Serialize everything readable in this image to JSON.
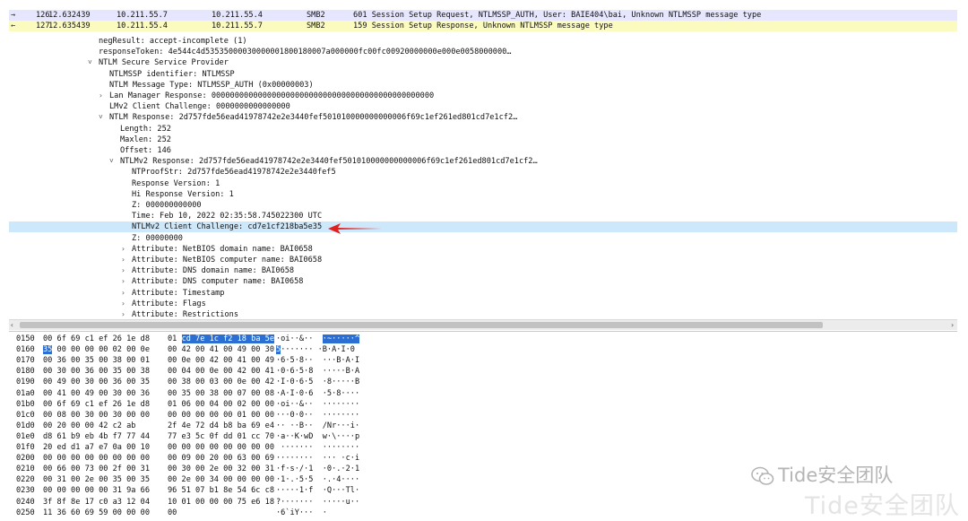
{
  "packets": [
    {
      "arrow": "→",
      "no": "126",
      "time": "12.632439",
      "src": "10.211.55.7",
      "dst": "10.211.55.4",
      "proto": "SMB2",
      "info": "601 Session Setup Request, NTLMSSP_AUTH, User: BAIE404\\bai, Unknown NTLMSSP message type"
    },
    {
      "arrow": "←",
      "no": "127",
      "time": "12.635439",
      "src": "10.211.55.4",
      "dst": "10.211.55.7",
      "proto": "SMB2",
      "info": "159 Session Setup Response, Unknown NTLMSSP message type"
    }
  ],
  "tree": [
    {
      "level": 0,
      "toggle": "",
      "text": "negResult: accept-incomplete (1)",
      "sel": false
    },
    {
      "level": 0,
      "toggle": "",
      "text": "responseToken: 4e544c4d53535000030000001800180007a000000fc00fc00920000000e000e0058000000…",
      "sel": false
    },
    {
      "level": 0,
      "toggle": "˅",
      "text": "NTLM Secure Service Provider",
      "sel": false
    },
    {
      "level": 1,
      "toggle": "",
      "text": "NTLMSSP identifier: NTLMSSP",
      "sel": false
    },
    {
      "level": 1,
      "toggle": "",
      "text": "NTLM Message Type: NTLMSSP_AUTH (0x00000003)",
      "sel": false
    },
    {
      "level": 1,
      "toggle": "›",
      "text": "Lan Manager Response: 000000000000000000000000000000000000000000000000",
      "sel": false
    },
    {
      "level": 1,
      "toggle": "",
      "text": "LMv2 Client Challenge: 0000000000000000",
      "sel": false
    },
    {
      "level": 1,
      "toggle": "˅",
      "text": "NTLM Response: 2d757fde56ead41978742e2e3440fef501010000000000006f69c1ef261ed801cd7e1cf2…",
      "sel": false
    },
    {
      "level": 2,
      "toggle": "",
      "text": "Length: 252",
      "sel": false
    },
    {
      "level": 2,
      "toggle": "",
      "text": "Maxlen: 252",
      "sel": false
    },
    {
      "level": 2,
      "toggle": "",
      "text": "Offset: 146",
      "sel": false
    },
    {
      "level": 2,
      "toggle": "˅",
      "text": "NTLMv2 Response: 2d757fde56ead41978742e2e3440fef501010000000000006f69c1ef261ed801cd7e1cf2…",
      "sel": false
    },
    {
      "level": 3,
      "toggle": "",
      "text": "NTProofStr: 2d757fde56ead41978742e2e3440fef5",
      "sel": false
    },
    {
      "level": 3,
      "toggle": "",
      "text": "Response Version: 1",
      "sel": false
    },
    {
      "level": 3,
      "toggle": "",
      "text": "Hi Response Version: 1",
      "sel": false
    },
    {
      "level": 3,
      "toggle": "",
      "text": "Z: 000000000000",
      "sel": false
    },
    {
      "level": 3,
      "toggle": "",
      "text": "Time: Feb 10, 2022 02:35:58.745022300 UTC",
      "sel": false
    },
    {
      "level": 3,
      "toggle": "",
      "text": "NTLMv2 Client Challenge: cd7e1cf218ba5e35",
      "sel": true
    },
    {
      "level": 3,
      "toggle": "",
      "text": "Z: 00000000",
      "sel": false
    },
    {
      "level": 3,
      "toggle": "›",
      "text": "Attribute: NetBIOS domain name: BAI0658",
      "sel": false
    },
    {
      "level": 3,
      "toggle": "›",
      "text": "Attribute: NetBIOS computer name: BAI0658",
      "sel": false
    },
    {
      "level": 3,
      "toggle": "›",
      "text": "Attribute: DNS domain name: BAI0658",
      "sel": false
    },
    {
      "level": 3,
      "toggle": "›",
      "text": "Attribute: DNS computer name: BAI0658",
      "sel": false
    },
    {
      "level": 3,
      "toggle": "›",
      "text": "Attribute: Timestamp",
      "sel": false
    },
    {
      "level": 3,
      "toggle": "›",
      "text": "Attribute: Flags",
      "sel": false
    },
    {
      "level": 3,
      "toggle": "›",
      "text": "Attribute: Restrictions",
      "sel": false
    }
  ],
  "scrollbar": {
    "left_arrow": "‹",
    "right_arrow": "›"
  },
  "hex": [
    {
      "off": "0150",
      "a": "00 6f 69 c1 ef 26 1e d8",
      "a_hl": "",
      "b_pre": "01 ",
      "b_hl": "cd 7e 1c f2 18 ba 5e",
      "b_post": "",
      "asc_pre": "·oi··&··",
      "asc_hl": "·~·····^"
    },
    {
      "off": "0160",
      "a": "",
      "a_hl": "35",
      "a_post": " 00 00 00 00 02 00 0e",
      "b_pre": "00 42 00 41 00 49 00 30",
      "b_hl": "",
      "b_post": "",
      "asc_hl2": "5",
      "asc_pre": "·······",
      "asc_post": " ·B·A·I·0"
    },
    {
      "off": "0170",
      "a": "00 36 00 35 00 38 00 01",
      "b_pre": "00 0e 00 42 00 41 00 49",
      "asc_pre": "·6·5·8··  ···B·A·I"
    },
    {
      "off": "0180",
      "a": "00 30 00 36 00 35 00 38",
      "b_pre": "00 04 00 0e 00 42 00 41",
      "asc_pre": "·0·6·5·8  ·····B·A"
    },
    {
      "off": "0190",
      "a": "00 49 00 30 00 36 00 35",
      "b_pre": "00 38 00 03 00 0e 00 42",
      "asc_pre": "·I·0·6·5  ·8·····B"
    },
    {
      "off": "01a0",
      "a": "00 41 00 49 00 30 00 36",
      "b_pre": "00 35 00 38 00 07 00 08",
      "asc_pre": "·A·I·0·6  ·5·8····"
    },
    {
      "off": "01b0",
      "a": "00 6f 69 c1 ef 26 1e d8",
      "b_pre": "01 06 00 04 00 02 00 00",
      "asc_pre": "·oi··&··  ········"
    },
    {
      "off": "01c0",
      "a": "00 08 00 30 00 30 00 00",
      "b_pre": "00 00 00 00 00 01 00 00",
      "asc_pre": "···0·0··  ········"
    },
    {
      "off": "01d0",
      "a": "00 20 00 00 42 c2 ab",
      "b_pre": "2f 4e 72 d4 b8 ba 69 e4",
      "asc_pre": "·· ··B··  /Nr···i·"
    },
    {
      "off": "01e0",
      "a": "d8 61 b9 eb 4b f7 77 44",
      "b_pre": "77 e3 5c 0f dd 01 cc 70",
      "asc_pre": "·a··K·wD  w·\\····p"
    },
    {
      "off": "01f0",
      "a": "20 ed d1 a7 e7 0a 00 10",
      "b_pre": "00 00 00 00 00 00 00 00",
      "asc_pre": " ·······  ········"
    },
    {
      "off": "0200",
      "a": "00 00 00 00 00 00 00 00",
      "b_pre": "00 09 00 20 00 63 00 69",
      "asc_pre": "········  ··· ·c·i"
    },
    {
      "off": "0210",
      "a": "00 66 00 73 00 2f 00 31",
      "b_pre": "00 30 00 2e 00 32 00 31",
      "asc_pre": "·f·s·/·1  ·0·.·2·1"
    },
    {
      "off": "0220",
      "a": "00 31 00 2e 00 35 00 35",
      "b_pre": "00 2e 00 34 00 00 00 00",
      "asc_pre": "·1·.·5·5  ·.·4····"
    },
    {
      "off": "0230",
      "a": "00 00 00 00 00 31 9a 66",
      "b_pre": "96 51 07 b1 8e 54 6c c8",
      "asc_pre": "·····1·f  ·Q···Tl·"
    },
    {
      "off": "0240",
      "a": "3f 8f 8e 17 c0 a3 12 04",
      "b_pre": "10 01 00 00 00 75 e6 18",
      "asc_pre": "?·······  ·····u··"
    },
    {
      "off": "0250",
      "a": "11 36 60 69 59 00 00 00",
      "b_pre": "00",
      "asc_pre": "·6`iY···  ·"
    }
  ],
  "watermark": {
    "line1": "Tide安全团队",
    "line2": "Tide安全团队"
  },
  "colors": {
    "selection": "#cde8fb",
    "hex_highlight": "#2a6fd1",
    "annotation_arrow": "#e0201f",
    "row1": "#e7e6ff",
    "row2": "#fbfbc0"
  }
}
